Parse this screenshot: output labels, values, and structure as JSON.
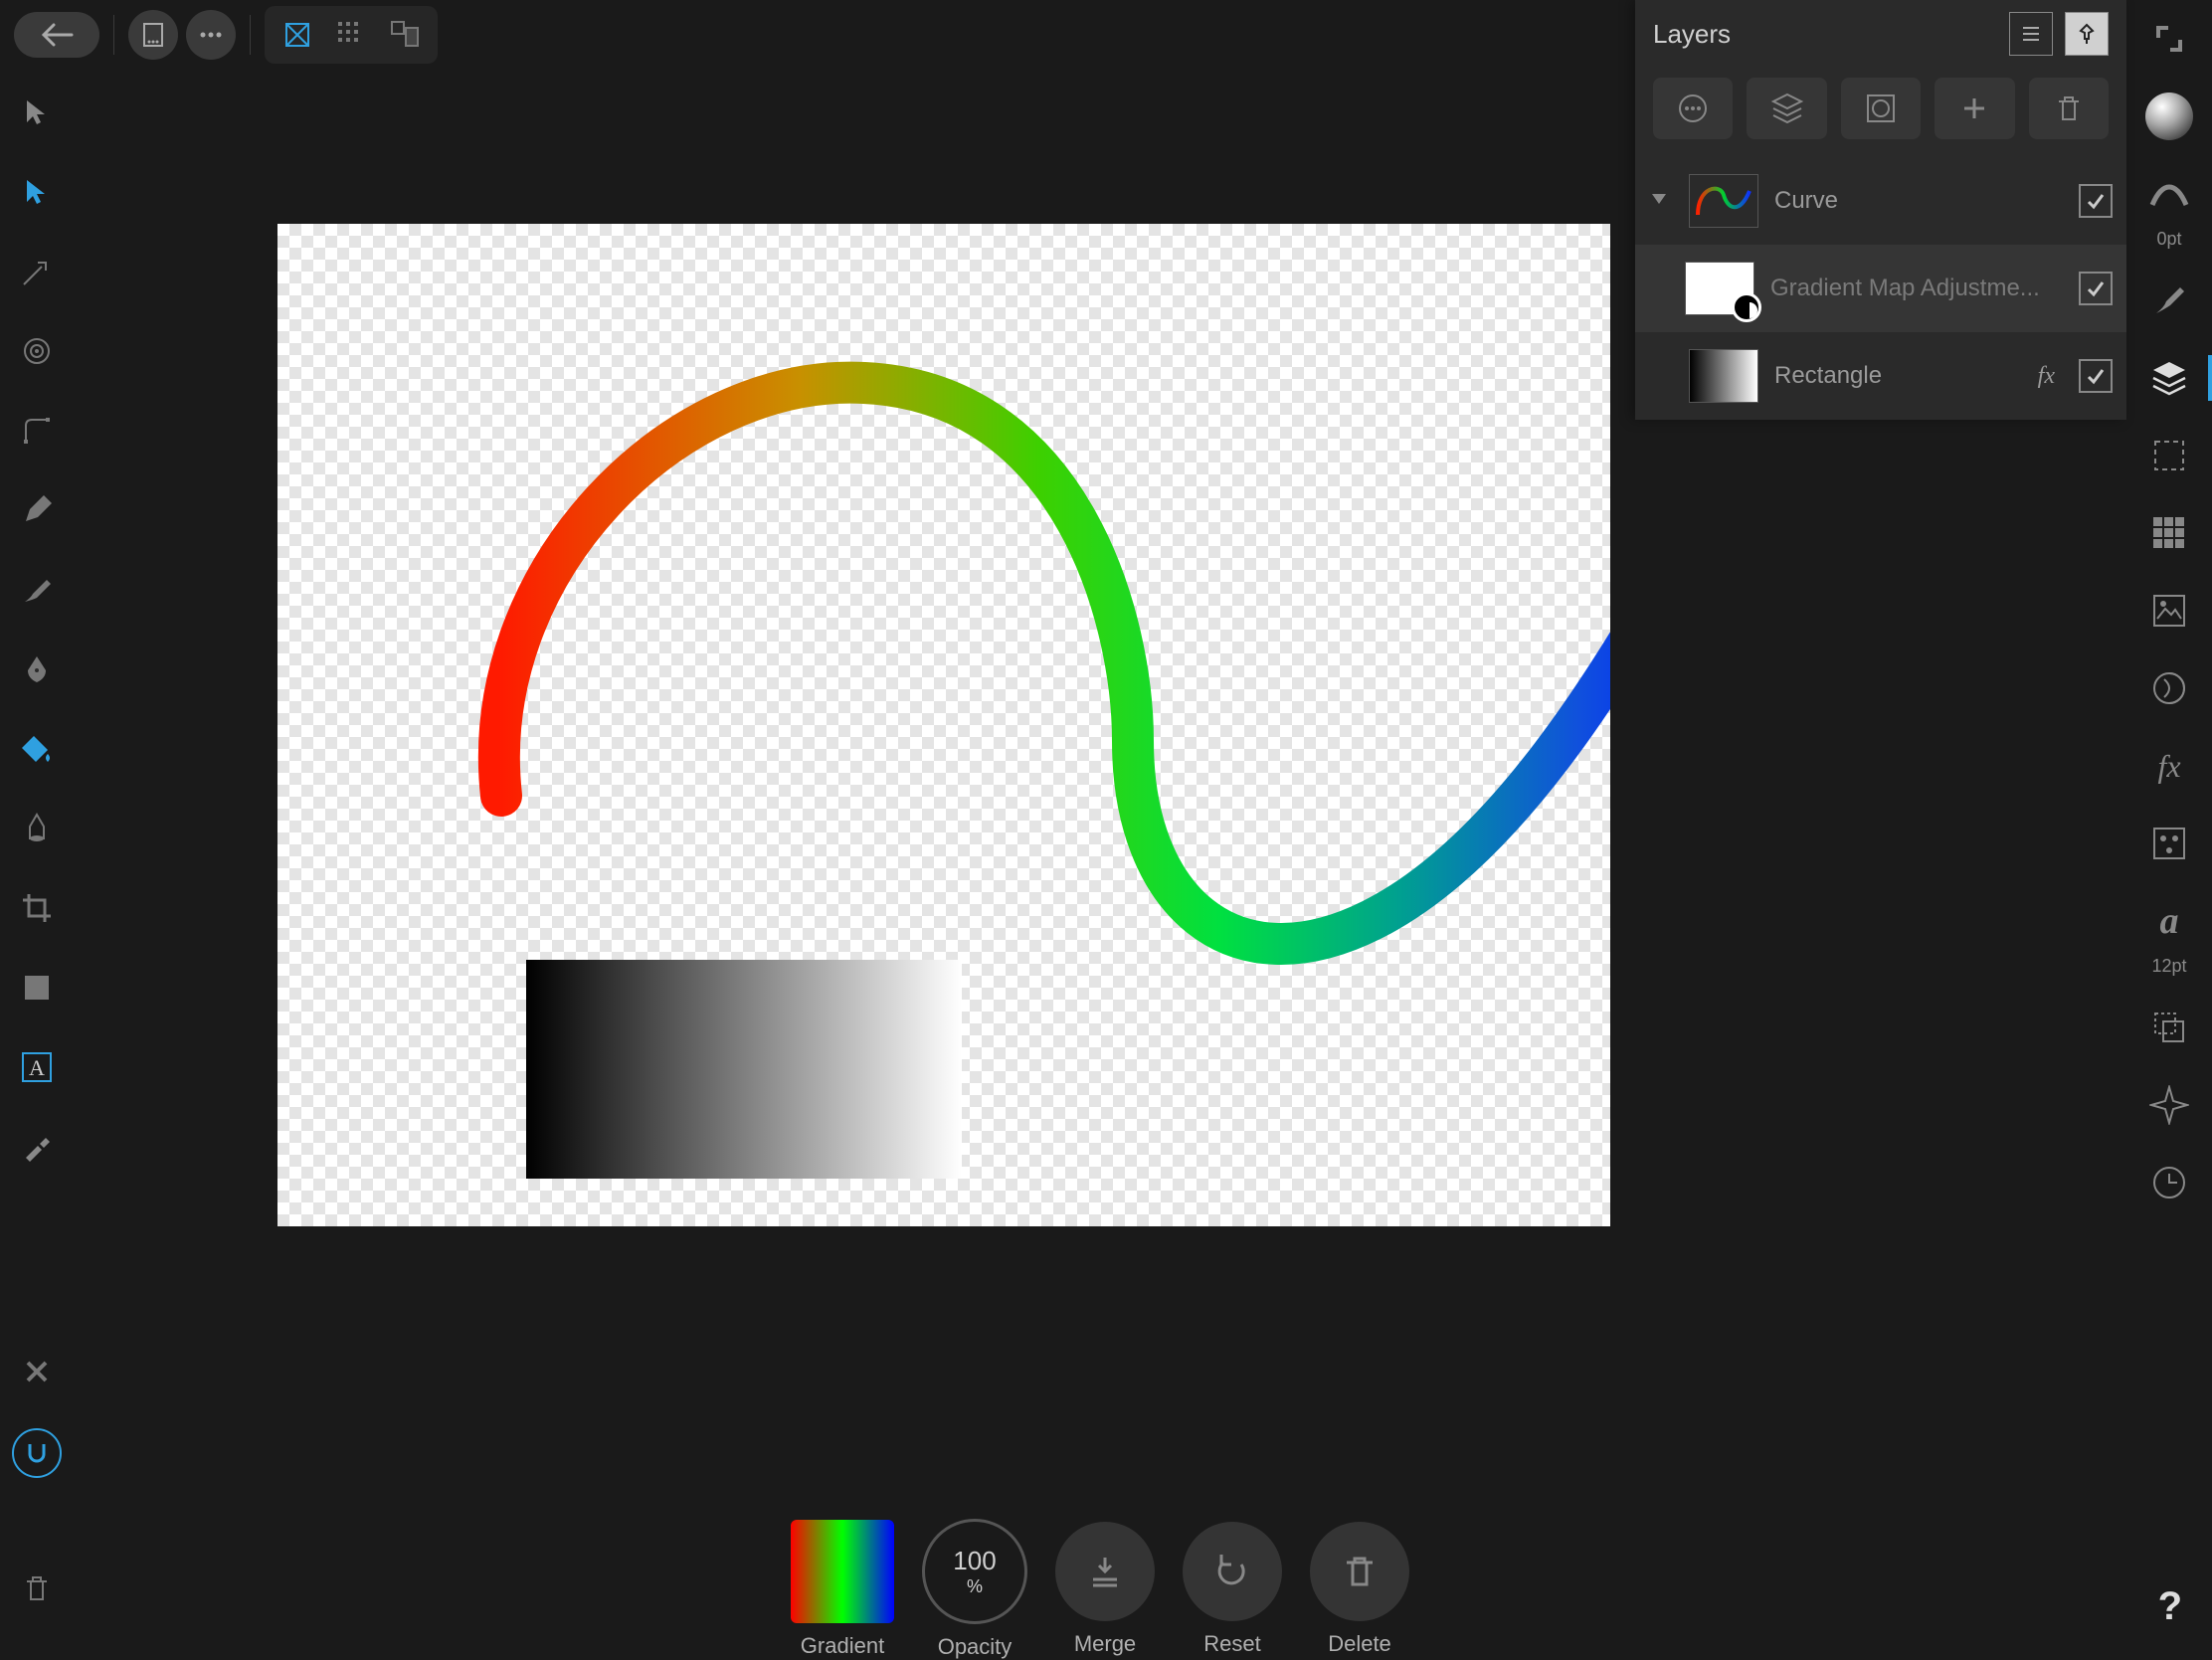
{
  "topbar": {
    "back": "Back"
  },
  "layers_panel": {
    "title": "Layers",
    "items": [
      {
        "name": "Curve"
      },
      {
        "name": "Gradient Map Adjustme..."
      },
      {
        "name": "Rectangle"
      }
    ]
  },
  "right_studio": {
    "stroke_width": "0pt",
    "font_size": "12pt"
  },
  "context_bar": {
    "gradient": "Gradient",
    "opacity_label": "Opacity",
    "opacity_value": "100",
    "opacity_unit": "%",
    "merge": "Merge",
    "reset": "Reset",
    "delete": "Delete"
  },
  "help": "?"
}
